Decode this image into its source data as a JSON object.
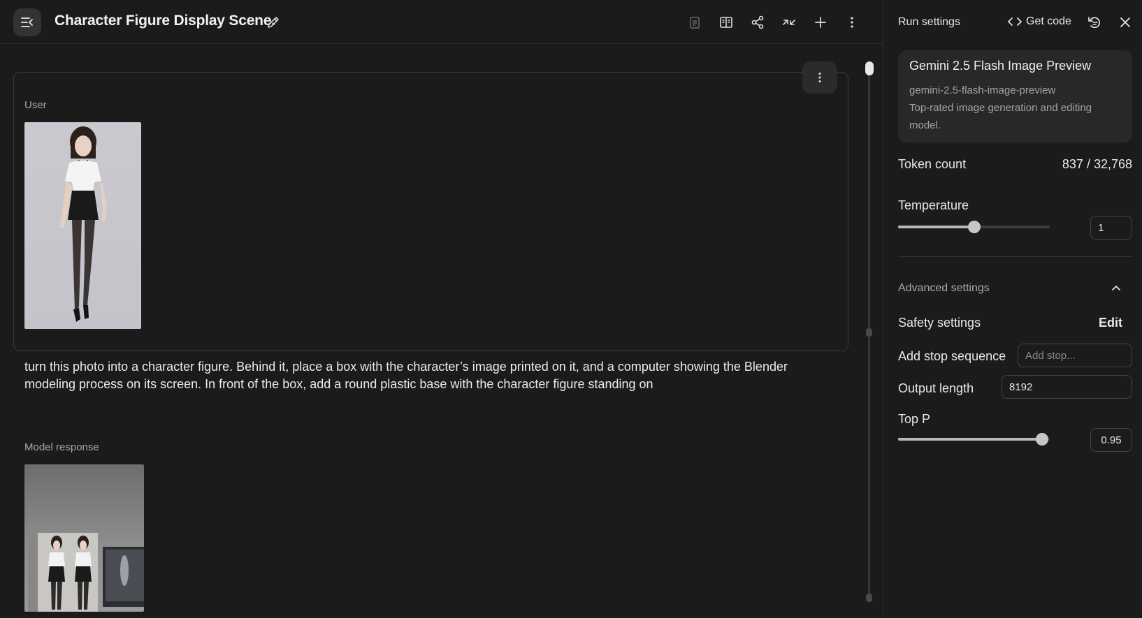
{
  "header": {
    "title": "Character Figure Display Scene."
  },
  "chat": {
    "user": {
      "role_label": "User",
      "prompt": "turn this photo into a character figure. Behind it, place a box with the character’s image printed on it, and a computer showing the Blender modeling process on its screen. In front of the box, add a round plastic base with the character figure standing on"
    },
    "model": {
      "role_label": "Model response"
    }
  },
  "panel": {
    "title": "Run settings",
    "get_code_label": "Get code",
    "model": {
      "name": "Gemini 2.5 Flash Image Preview",
      "id": "gemini-2.5-flash-image-preview",
      "description": "Top-rated image generation and editing model."
    },
    "token_count": {
      "label": "Token count",
      "value": "837 / 32,768"
    },
    "temperature": {
      "label": "Temperature",
      "value": "1",
      "fraction": 0.5
    },
    "advanced": {
      "label": "Advanced settings",
      "expanded": true
    },
    "safety": {
      "label": "Safety settings",
      "edit_label": "Edit"
    },
    "stop_sequence": {
      "label": "Add stop sequence",
      "placeholder": "Add stop..."
    },
    "output_length": {
      "label": "Output length",
      "value": "8192"
    },
    "top_p": {
      "label": "Top P",
      "value": "0.95",
      "fraction": 0.95
    }
  },
  "icons": {
    "menu": "menu-collapse-icon",
    "edit_title": "pencil-icon",
    "toolbar": [
      "clipboard-icon",
      "compare-icon",
      "share-icon",
      "compress-icon",
      "add-icon",
      "more-vertical-icon"
    ],
    "panel": [
      "code-icon",
      "reset-settings-icon",
      "close-icon"
    ]
  },
  "colors": {
    "background": "#1b1b1b",
    "card": "#282828",
    "border": "#3a3a3a",
    "text": "#e3e3e3",
    "muted": "#a8a8a8"
  }
}
